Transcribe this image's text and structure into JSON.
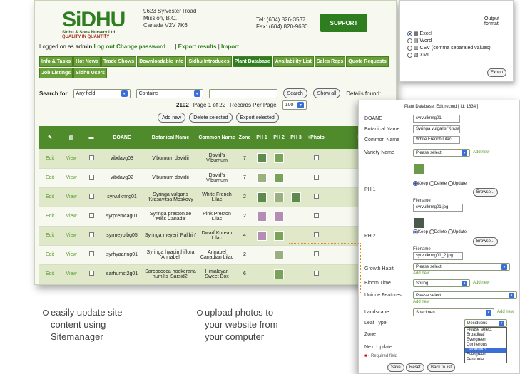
{
  "header": {
    "logo": "SiDHU",
    "logo_sub": "Sidhu & Sons Nursery Ltd",
    "logo_quality": "QUALITY IN QUANTITY",
    "address": [
      "9623 Sylvester Road",
      "Mission, B.C.",
      "Canada V2V 7K6"
    ],
    "tel": "Tel: (604) 826-3537",
    "fax": "Fax: (604) 820-9680",
    "support": "SUPPORT"
  },
  "logbar": {
    "prefix": "Logged on as",
    "user": "admin",
    "logout": "Log out",
    "change_password": "Change password",
    "sep": "|",
    "export": "Export results",
    "import": "Import"
  },
  "tabs": [
    "Info & Tasks",
    "Hot News",
    "Trade Shows",
    "Downloadable Info",
    "Sidhu Introduces",
    "Plant Database",
    "Availability List",
    "Sales Reps",
    "Quote Requests",
    "Job Listings",
    "Sidhu Users"
  ],
  "active_tab": "Plant Database",
  "search": {
    "label": "Search for",
    "field": "Any field",
    "op": "Contains",
    "search_btn": "Search",
    "showall_btn": "Show all",
    "details": "Details found:"
  },
  "paging": {
    "count": "2102",
    "page_text": "Page 1 of 22",
    "rpp_label": "Records Per Page:",
    "rpp": "100"
  },
  "actions": {
    "add": "Add new",
    "delete": "Delete selected",
    "export": "Export selected"
  },
  "grid": {
    "headers": [
      "DOANE",
      "Botanical Name",
      "Common Name",
      "Zone",
      "PH 1",
      "PH 2",
      "PH 3",
      "+Photo",
      "Hid"
    ],
    "rows": [
      {
        "edit": "Edit",
        "view": "View",
        "doane": "vibdavg03",
        "botanical": "Viburnum davidii",
        "common": "David's Viburnum",
        "zone": "7"
      },
      {
        "edit": "Edit",
        "view": "View",
        "doane": "vibdavg02",
        "botanical": "Viburnum davidii",
        "common": "David's Viburnum",
        "zone": "7"
      },
      {
        "edit": "Edit",
        "view": "View",
        "doane": "syrvulkrmg01",
        "botanical": "Syringa vulgaris 'Krasavitsa Moskovy",
        "common": "White French Lilac",
        "zone": "2"
      },
      {
        "edit": "Edit",
        "view": "View",
        "doane": "syrpremcag01",
        "botanical": "Syringa prestoniae 'Miss Canada'",
        "common": "Pink Preston Lilac",
        "zone": "2"
      },
      {
        "edit": "Edit",
        "view": "View",
        "doane": "syrmeypibg05",
        "botanical": "Syringa meyeri 'Palibin'",
        "common": "Dwarf Korean Lilac",
        "zone": "4"
      },
      {
        "edit": "Edit",
        "view": "View",
        "doane": "syrhyaanng01",
        "botanical": "Syringa hyacinthiflora 'Annabel'",
        "common": "Annabel Canadian Lilac",
        "zone": "2"
      },
      {
        "edit": "Edit",
        "view": "View",
        "doane": "sarhumst2g01",
        "botanical": "Sarcococca hookerana humilis 'Sarsid2'",
        "common": "Himalayan Sweet Box",
        "zone": "6"
      }
    ]
  },
  "export_panel": {
    "title": "Output format",
    "options": [
      "Excel",
      "Word",
      "CSV (comma separated values)",
      "XML"
    ],
    "selected": "Excel",
    "button": "Export"
  },
  "edit_panel": {
    "title": "Plant Database, Edit record [ Id: 1834 ]",
    "doane_label": "DOANE",
    "doane": "syrvulkrmg01",
    "botanical_label": "Botanical Name",
    "botanical": "Syringa vulgaris 'Krasavitsa",
    "common_label": "Common Name",
    "common": "White French Lilac",
    "variety_label": "Variety Name",
    "variety": "Please select",
    "add_new": "Add new",
    "ph1_label": "PH 1",
    "ph2_label": "PH 2",
    "keep": "Keep",
    "delete": "Delete",
    "update": "Update",
    "browse": "Browse...",
    "filename_label": "Filename",
    "file1": "syrvulkrmg01.jpg",
    "file2": "syrvulkrmg01_2.jpg",
    "growth_label": "Growth Habit",
    "growth": "Please select",
    "bloom_label": "Bloom Time",
    "bloom": "Spring",
    "unique_label": "Unique Features",
    "unique": "Please select",
    "landscape_label": "Landscape",
    "landscape": "Specimen",
    "leaf_label": "Leaf Type",
    "leaf": "Deciduous",
    "zone_label": "Zone",
    "next_label": "Next Update",
    "leaf_options": [
      "Please select",
      "Broadleaf Evergreen",
      "Coniferous",
      "Deciduous",
      "Evergreen",
      "Perennial"
    ],
    "leaf_selected": "Deciduous",
    "required": "- Required field",
    "save": "Save",
    "reset": "Reset",
    "back": "Back to list"
  },
  "features": {
    "left": [
      "easily update site",
      "content using",
      "Sitemanager"
    ],
    "right": [
      "upload photos to",
      "your website from",
      "your computer"
    ]
  }
}
